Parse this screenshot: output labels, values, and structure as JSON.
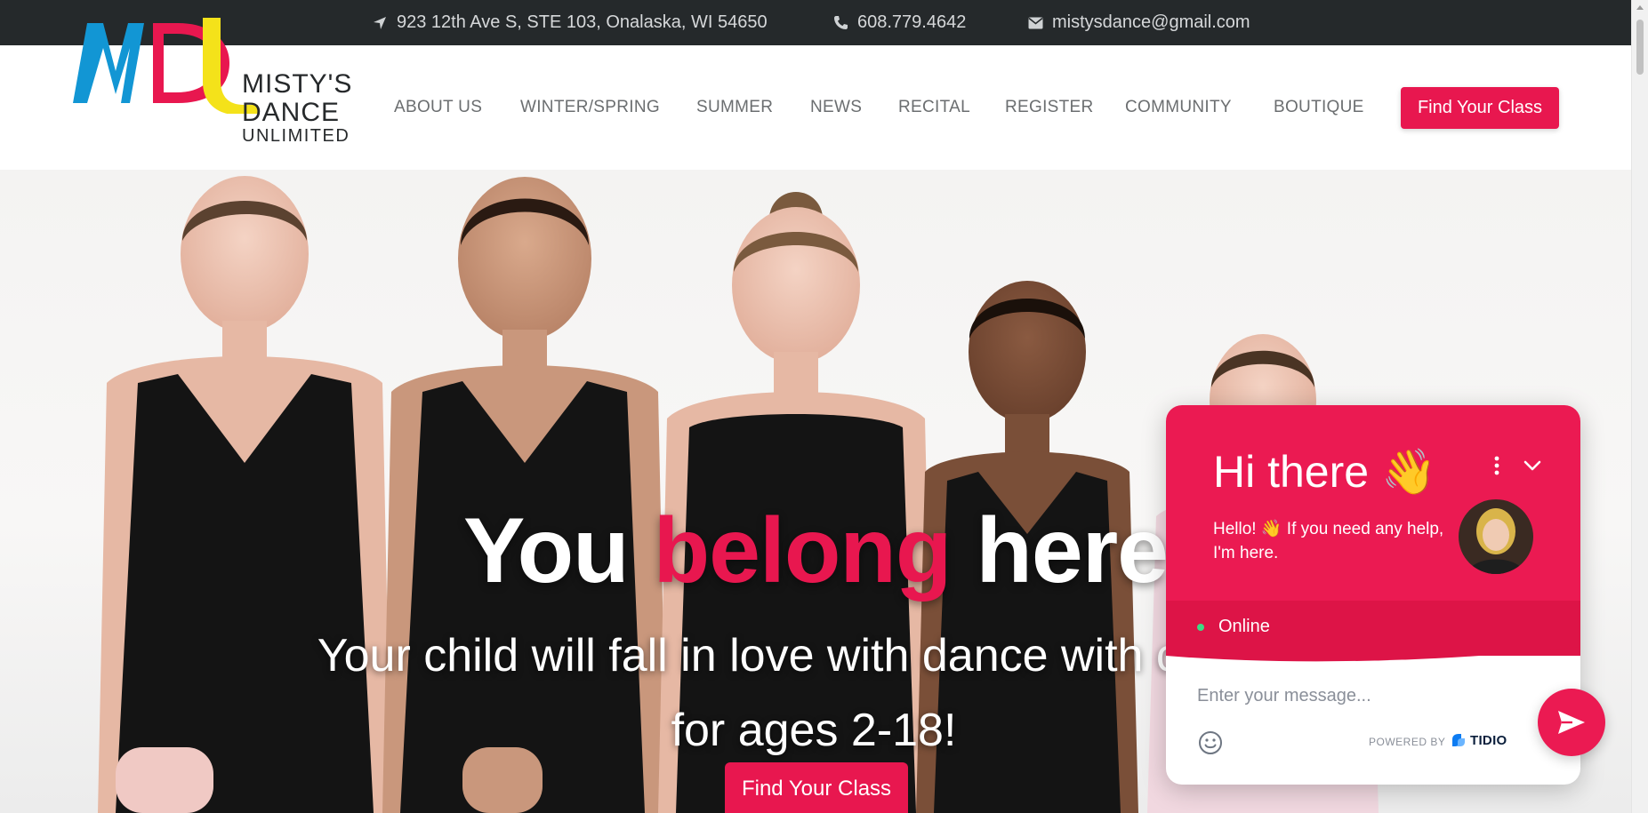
{
  "topbar": {
    "address": "923 12th Ave S, STE 103, Onalaska, WI 54650",
    "phone": "608.779.4642",
    "email": "mistysdance@gmail.com",
    "address_icon": "location-arrow-icon",
    "phone_icon": "phone-icon",
    "email_icon": "envelope-icon"
  },
  "logo": {
    "line1": "MISTY'S",
    "line2": "DANCE",
    "line3": "UNLIMITED",
    "colors": {
      "blue": "#1296d4",
      "pink": "#e8174f",
      "yellow": "#f4e21a"
    }
  },
  "nav": {
    "items": [
      {
        "label": "ABOUT US"
      },
      {
        "label": "WINTER/SPRING"
      },
      {
        "label": "SUMMER"
      },
      {
        "label": "NEWS"
      },
      {
        "label": "RECITAL"
      },
      {
        "label": "REGISTER"
      },
      {
        "label": "COMMUNITY"
      },
      {
        "label": "BOUTIQUE"
      }
    ],
    "cta_label": "Find Your Class"
  },
  "hero": {
    "headline_pre": "You",
    "headline_accent": "belong",
    "headline_post": "here",
    "subline": "Your child will fall in love with dance with classes for ages 2-18!",
    "cta_label": "Find Your Class"
  },
  "chat": {
    "greeting": "Hi there 👋",
    "message": "Hello! 👋 If you need any help, I'm here.",
    "status": "Online",
    "input_placeholder": "Enter your message...",
    "powered_by": "POWERED BY",
    "brand": "TIDIO",
    "icons": [
      "more-vertical-icon",
      "chevron-down-icon",
      "emoji-icon",
      "send-icon"
    ]
  },
  "theme": {
    "accent": "#e8174f",
    "topbar_bg": "#25292b"
  }
}
